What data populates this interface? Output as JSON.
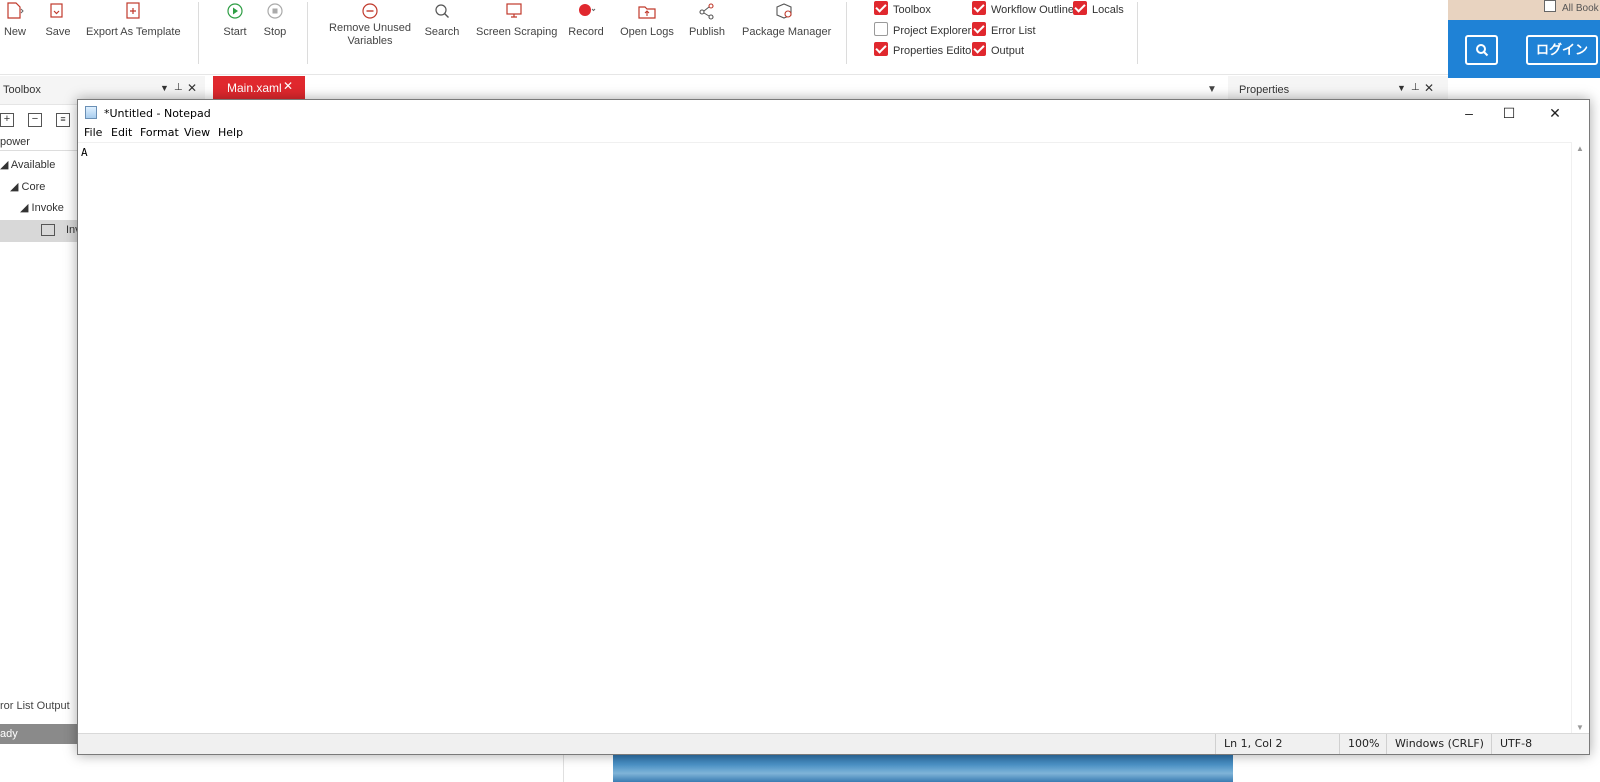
{
  "ribbon": {
    "buttons": [
      {
        "label": "New",
        "icon": "new-file-icon"
      },
      {
        "label": "Save",
        "icon": "save-icon"
      },
      {
        "label": "Export As Template",
        "icon": "export-template-icon"
      },
      {
        "label": "Start",
        "icon": "play-icon"
      },
      {
        "label": "Stop",
        "icon": "stop-icon"
      },
      {
        "label": "Remove Unused\nVariables",
        "icon": "remove-variables-icon"
      },
      {
        "label": "Search",
        "icon": "search-icon"
      },
      {
        "label": "Screen Scraping",
        "icon": "screen-scraping-icon"
      },
      {
        "label": "Record",
        "icon": "record-icon"
      },
      {
        "label": "Open Logs",
        "icon": "open-logs-icon"
      },
      {
        "label": "Publish",
        "icon": "publish-icon"
      },
      {
        "label": "Package Manager",
        "icon": "package-manager-icon"
      }
    ],
    "panels": [
      {
        "label": "Toolbox",
        "checked": true
      },
      {
        "label": "Project Explorer",
        "checked": false
      },
      {
        "label": "Properties Editor",
        "checked": true
      },
      {
        "label": "Workflow Outline",
        "checked": true
      },
      {
        "label": "Error List",
        "checked": true
      },
      {
        "label": "Output",
        "checked": true
      },
      {
        "label": "Locals",
        "checked": true
      }
    ]
  },
  "studio": {
    "toolbox_title": "Toolbox",
    "search_text": "power",
    "tree": [
      "Available",
      "Core",
      "Invoke",
      "Inv"
    ],
    "document_tab": "Main.xaml",
    "properties_title": "Properties",
    "bottom_tabs": "ror List   Output",
    "status": "ady"
  },
  "web": {
    "all_books": "All Book",
    "login_label": "ログイン"
  },
  "notepad": {
    "title": "*Untitled - Notepad",
    "menu": [
      "File",
      "Edit",
      "Format",
      "View",
      "Help"
    ],
    "content": "A",
    "status": {
      "position": "Ln 1, Col 2",
      "zoom": "100%",
      "line_ending": "Windows (CRLF)",
      "encoding": "UTF-8"
    }
  },
  "colors": {
    "accent_red": "#e0282e",
    "web_blue": "#1f82d6"
  }
}
